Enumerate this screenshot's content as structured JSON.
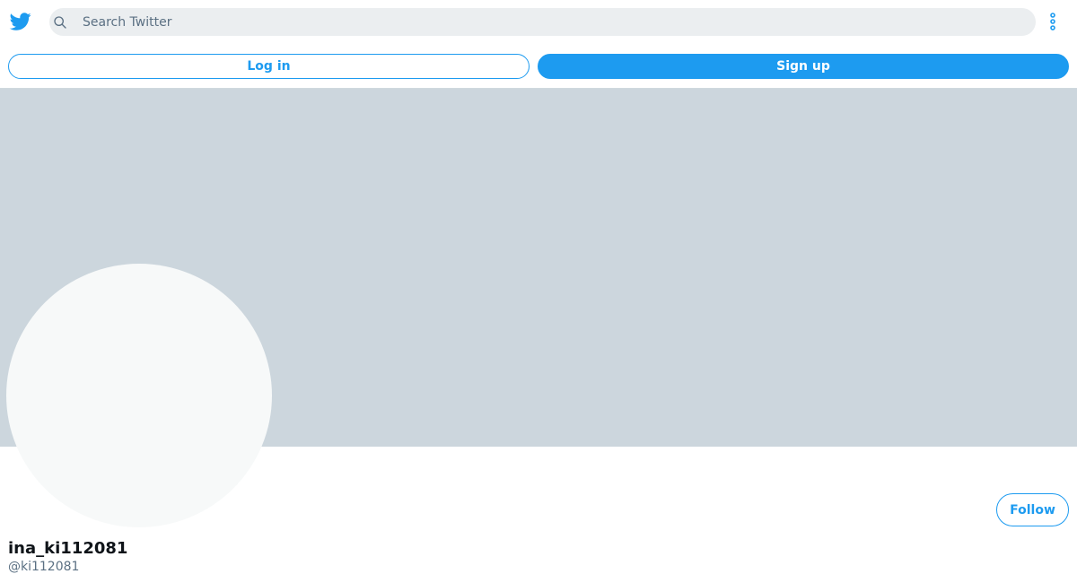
{
  "header": {
    "logo_icon": "twitter-bird-icon",
    "brand_color": "#1d9bf0",
    "search": {
      "icon": "search-icon",
      "placeholder": "Search Twitter",
      "value": ""
    },
    "more_icon": "more-vertical-icon"
  },
  "auth": {
    "login_label": "Log in",
    "signup_label": "Sign up"
  },
  "profile": {
    "banner_color": "#ccd6dd",
    "follow_label": "Follow",
    "display_name": "ina_ki112081",
    "handle": "@ki112081"
  }
}
